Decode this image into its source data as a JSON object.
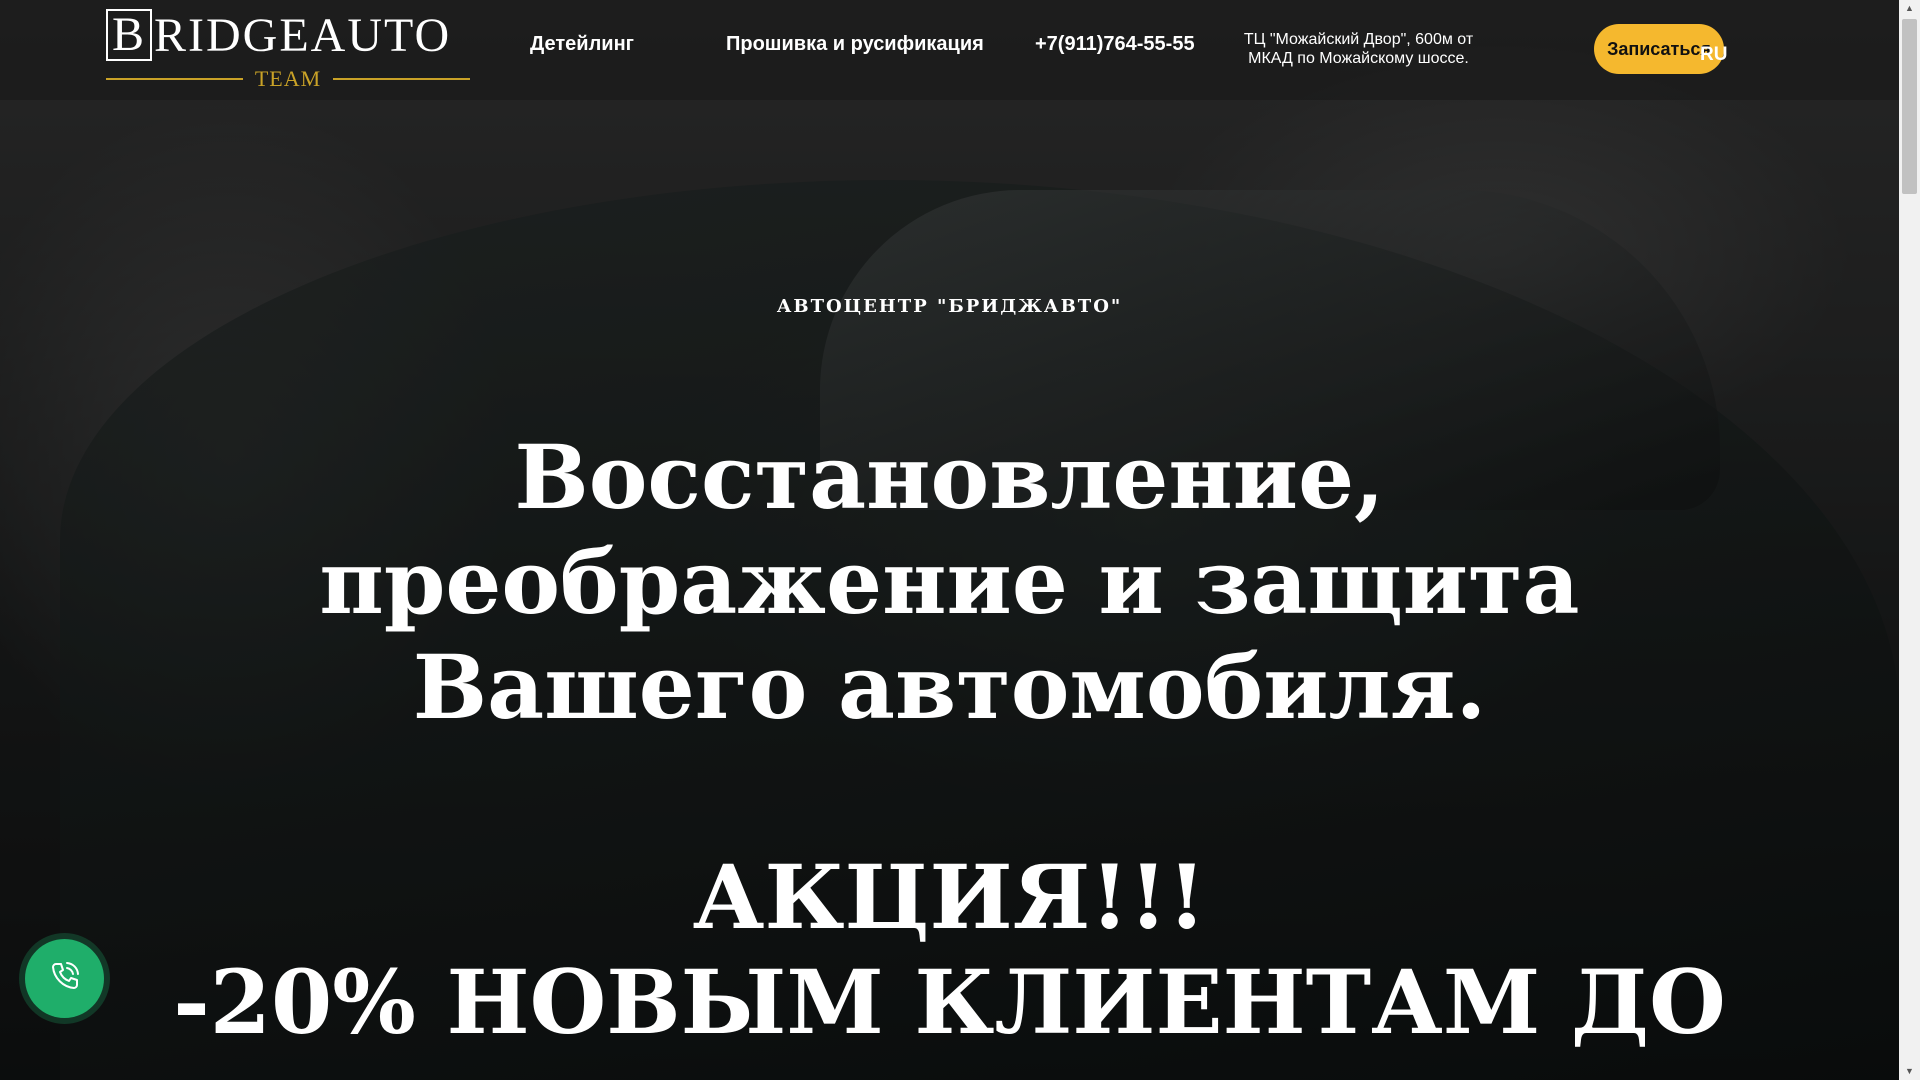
{
  "header": {
    "logo_main": "RIDGEAUTO",
    "logo_letter": "B",
    "logo_sub": "TEAM",
    "nav": [
      {
        "label": "Детейлинг"
      },
      {
        "label": "Прошивка и русификация"
      }
    ],
    "phone": "+7(911)764-55-55",
    "address_line1": "ТЦ \"Можайский Двор\", 600м от",
    "address_line2": "МКАД по Можайскому шоссе.",
    "cta_label": "Записаться",
    "lang": "RU"
  },
  "hero": {
    "subtitle": "АВТОЦЕНТР \"БРИДЖАВТО\"",
    "headline_line1": "Восстановление,",
    "headline_line2": "преображение и защита",
    "headline_line3": "Вашего автомобиля.",
    "promo_line1": "АКЦИЯ!!!",
    "promo_line2": "-20% НОВЫМ КЛИЕНТАМ ДО"
  },
  "widgets": {
    "call_icon": "phone-ringing-icon"
  },
  "colors": {
    "accent": "#f5b82e",
    "logo_gold": "#c9a227",
    "call_green": "#1fae6a"
  }
}
